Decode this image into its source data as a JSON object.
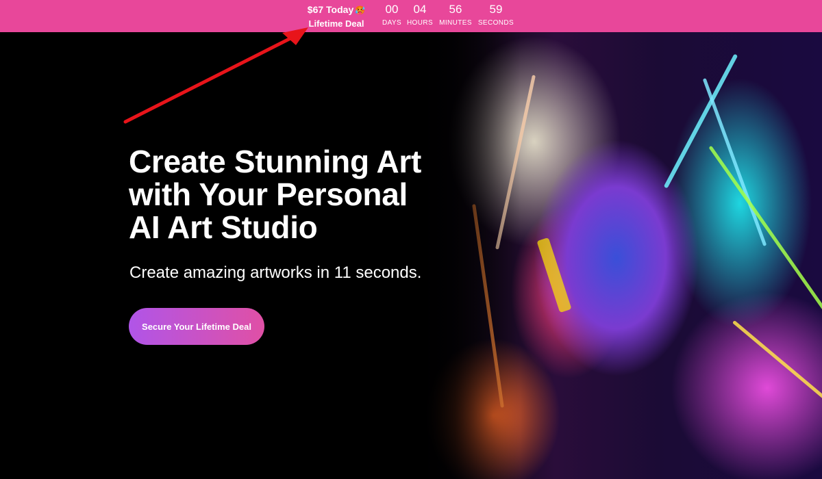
{
  "promo": {
    "price_text": "$67 Today",
    "emoji": "🥵",
    "deal_label": "Lifetime Deal"
  },
  "countdown": {
    "days": {
      "value": "00",
      "label": "DAYS"
    },
    "hours": {
      "value": "04",
      "label": "HOURS"
    },
    "minutes": {
      "value": "56",
      "label": "MINUTES"
    },
    "seconds": {
      "value": "59",
      "label": "SECONDS"
    }
  },
  "hero": {
    "headline_lines": [
      "Create Stunning Art",
      "with Your Personal",
      "AI Art Studio"
    ],
    "subheadline": "Create amazing artworks in 11 seconds.",
    "cta_label": "Secure Your Lifetime Deal"
  },
  "colors": {
    "topbar": "#e8479a",
    "background": "#000000",
    "cta_start": "#b055e8",
    "cta_end": "#e050a5",
    "annotation_arrow": "#e8141a"
  }
}
